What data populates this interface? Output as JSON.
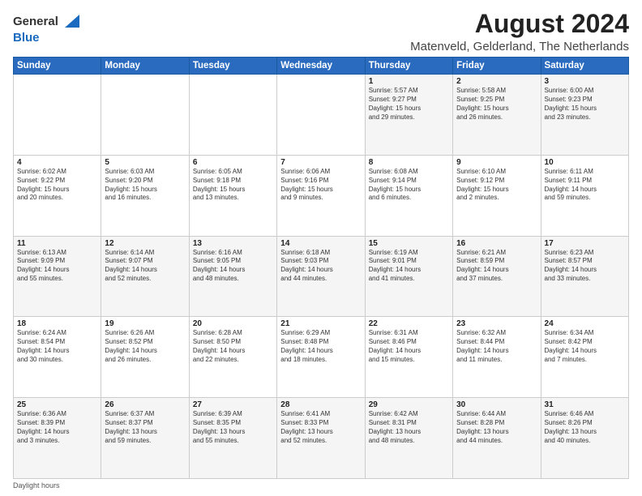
{
  "header": {
    "logo_general": "General",
    "logo_blue": "Blue",
    "title": "August 2024",
    "subtitle": "Matenveld, Gelderland, The Netherlands"
  },
  "calendar": {
    "days_of_week": [
      "Sunday",
      "Monday",
      "Tuesday",
      "Wednesday",
      "Thursday",
      "Friday",
      "Saturday"
    ],
    "weeks": [
      [
        {
          "day": "",
          "info": ""
        },
        {
          "day": "",
          "info": ""
        },
        {
          "day": "",
          "info": ""
        },
        {
          "day": "",
          "info": ""
        },
        {
          "day": "1",
          "info": "Sunrise: 5:57 AM\nSunset: 9:27 PM\nDaylight: 15 hours\nand 29 minutes."
        },
        {
          "day": "2",
          "info": "Sunrise: 5:58 AM\nSunset: 9:25 PM\nDaylight: 15 hours\nand 26 minutes."
        },
        {
          "day": "3",
          "info": "Sunrise: 6:00 AM\nSunset: 9:23 PM\nDaylight: 15 hours\nand 23 minutes."
        }
      ],
      [
        {
          "day": "4",
          "info": "Sunrise: 6:02 AM\nSunset: 9:22 PM\nDaylight: 15 hours\nand 20 minutes."
        },
        {
          "day": "5",
          "info": "Sunrise: 6:03 AM\nSunset: 9:20 PM\nDaylight: 15 hours\nand 16 minutes."
        },
        {
          "day": "6",
          "info": "Sunrise: 6:05 AM\nSunset: 9:18 PM\nDaylight: 15 hours\nand 13 minutes."
        },
        {
          "day": "7",
          "info": "Sunrise: 6:06 AM\nSunset: 9:16 PM\nDaylight: 15 hours\nand 9 minutes."
        },
        {
          "day": "8",
          "info": "Sunrise: 6:08 AM\nSunset: 9:14 PM\nDaylight: 15 hours\nand 6 minutes."
        },
        {
          "day": "9",
          "info": "Sunrise: 6:10 AM\nSunset: 9:12 PM\nDaylight: 15 hours\nand 2 minutes."
        },
        {
          "day": "10",
          "info": "Sunrise: 6:11 AM\nSunset: 9:11 PM\nDaylight: 14 hours\nand 59 minutes."
        }
      ],
      [
        {
          "day": "11",
          "info": "Sunrise: 6:13 AM\nSunset: 9:09 PM\nDaylight: 14 hours\nand 55 minutes."
        },
        {
          "day": "12",
          "info": "Sunrise: 6:14 AM\nSunset: 9:07 PM\nDaylight: 14 hours\nand 52 minutes."
        },
        {
          "day": "13",
          "info": "Sunrise: 6:16 AM\nSunset: 9:05 PM\nDaylight: 14 hours\nand 48 minutes."
        },
        {
          "day": "14",
          "info": "Sunrise: 6:18 AM\nSunset: 9:03 PM\nDaylight: 14 hours\nand 44 minutes."
        },
        {
          "day": "15",
          "info": "Sunrise: 6:19 AM\nSunset: 9:01 PM\nDaylight: 14 hours\nand 41 minutes."
        },
        {
          "day": "16",
          "info": "Sunrise: 6:21 AM\nSunset: 8:59 PM\nDaylight: 14 hours\nand 37 minutes."
        },
        {
          "day": "17",
          "info": "Sunrise: 6:23 AM\nSunset: 8:57 PM\nDaylight: 14 hours\nand 33 minutes."
        }
      ],
      [
        {
          "day": "18",
          "info": "Sunrise: 6:24 AM\nSunset: 8:54 PM\nDaylight: 14 hours\nand 30 minutes."
        },
        {
          "day": "19",
          "info": "Sunrise: 6:26 AM\nSunset: 8:52 PM\nDaylight: 14 hours\nand 26 minutes."
        },
        {
          "day": "20",
          "info": "Sunrise: 6:28 AM\nSunset: 8:50 PM\nDaylight: 14 hours\nand 22 minutes."
        },
        {
          "day": "21",
          "info": "Sunrise: 6:29 AM\nSunset: 8:48 PM\nDaylight: 14 hours\nand 18 minutes."
        },
        {
          "day": "22",
          "info": "Sunrise: 6:31 AM\nSunset: 8:46 PM\nDaylight: 14 hours\nand 15 minutes."
        },
        {
          "day": "23",
          "info": "Sunrise: 6:32 AM\nSunset: 8:44 PM\nDaylight: 14 hours\nand 11 minutes."
        },
        {
          "day": "24",
          "info": "Sunrise: 6:34 AM\nSunset: 8:42 PM\nDaylight: 14 hours\nand 7 minutes."
        }
      ],
      [
        {
          "day": "25",
          "info": "Sunrise: 6:36 AM\nSunset: 8:39 PM\nDaylight: 14 hours\nand 3 minutes."
        },
        {
          "day": "26",
          "info": "Sunrise: 6:37 AM\nSunset: 8:37 PM\nDaylight: 13 hours\nand 59 minutes."
        },
        {
          "day": "27",
          "info": "Sunrise: 6:39 AM\nSunset: 8:35 PM\nDaylight: 13 hours\nand 55 minutes."
        },
        {
          "day": "28",
          "info": "Sunrise: 6:41 AM\nSunset: 8:33 PM\nDaylight: 13 hours\nand 52 minutes."
        },
        {
          "day": "29",
          "info": "Sunrise: 6:42 AM\nSunset: 8:31 PM\nDaylight: 13 hours\nand 48 minutes."
        },
        {
          "day": "30",
          "info": "Sunrise: 6:44 AM\nSunset: 8:28 PM\nDaylight: 13 hours\nand 44 minutes."
        },
        {
          "day": "31",
          "info": "Sunrise: 6:46 AM\nSunset: 8:26 PM\nDaylight: 13 hours\nand 40 minutes."
        }
      ]
    ]
  },
  "footer": {
    "note": "Daylight hours"
  }
}
